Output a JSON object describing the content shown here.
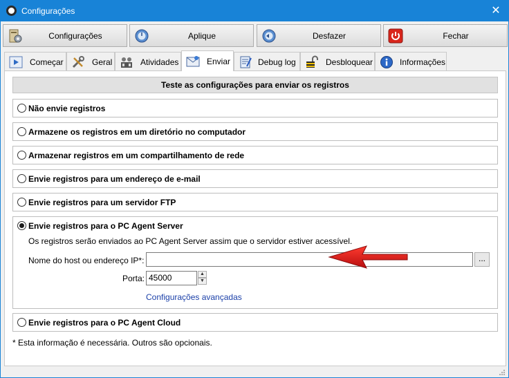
{
  "window": {
    "title": "Configurações",
    "close_glyph": "✕"
  },
  "toolbar": {
    "configuracoes": "Configurações",
    "aplique": "Aplique",
    "desfazer": "Desfazer",
    "fechar": "Fechar"
  },
  "tabs": [
    {
      "label": "Começar",
      "icon": "play-icon"
    },
    {
      "label": "Geral",
      "icon": "tools-icon"
    },
    {
      "label": "Atividades",
      "icon": "people-icon"
    },
    {
      "label": "Enviar",
      "icon": "envelope-icon",
      "active": true
    },
    {
      "label": "Debug log",
      "icon": "notepad-icon"
    },
    {
      "label": "Desbloquear",
      "icon": "unlock-icon"
    },
    {
      "label": "Informações",
      "icon": "info-icon"
    }
  ],
  "panel": {
    "header": "Teste as configurações para enviar os registros",
    "options": [
      "Não envie registros",
      "Armazene os registros em um diretório no computador",
      "Armazenar registros em um compartilhamento de rede",
      "Envie registros para um endereço de e-mail",
      "Envie registros para um servidor FTP",
      "Envie registros para o PC Agent Server",
      "Envie registros para o PC Agent Cloud"
    ],
    "selected_option": 5,
    "server": {
      "description": "Os registros serão enviados ao PC Agent Server assim que o servidor estiver acessível.",
      "host_label": "Nome do host ou endereço IP*:",
      "host_value": "",
      "browse_label": "...",
      "port_label": "Porta:",
      "port_value": "45000",
      "advanced_link": "Configurações avançadas"
    },
    "note": "* Esta informação é necessária. Outros são opcionais."
  },
  "colors": {
    "titlebar": "#1883d7",
    "arrow": "#e0141b",
    "link": "#1a3fa8"
  }
}
